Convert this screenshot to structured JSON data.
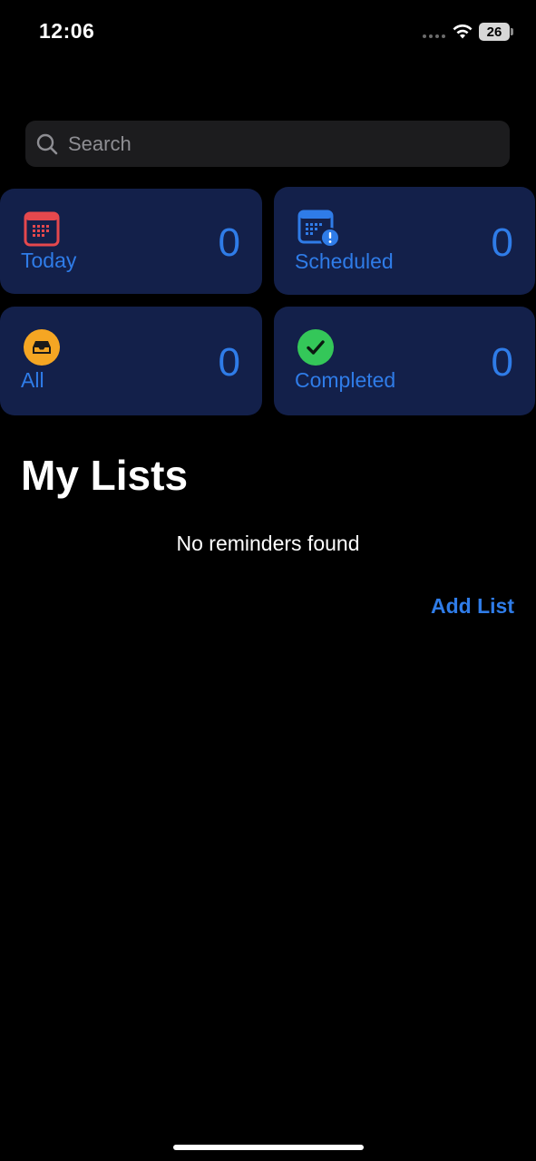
{
  "status_bar": {
    "time": "12:06",
    "battery": "26",
    "icons": [
      "cellular-icon",
      "wifi-icon",
      "battery-icon"
    ]
  },
  "search": {
    "placeholder": "Search",
    "value": ""
  },
  "smart_lists": [
    {
      "id": "today",
      "label": "Today",
      "count": "0",
      "icon": "calendar-icon",
      "icon_color": "#e5484d"
    },
    {
      "id": "scheduled",
      "label": "Scheduled",
      "count": "0",
      "icon": "calendar-alert-icon",
      "icon_color": "#2f7ce8"
    },
    {
      "id": "all",
      "label": "All",
      "count": "0",
      "icon": "tray-icon",
      "icon_color": "#f5a623"
    },
    {
      "id": "completed",
      "label": "Completed",
      "count": "0",
      "icon": "checkmark-icon",
      "icon_color": "#34c759"
    }
  ],
  "my_lists": {
    "title": "My Lists",
    "empty_message": "No reminders found",
    "add_button": "Add List"
  },
  "colors": {
    "accent": "#2f7ce8",
    "tile_background": "#13204a",
    "background": "#000000"
  }
}
